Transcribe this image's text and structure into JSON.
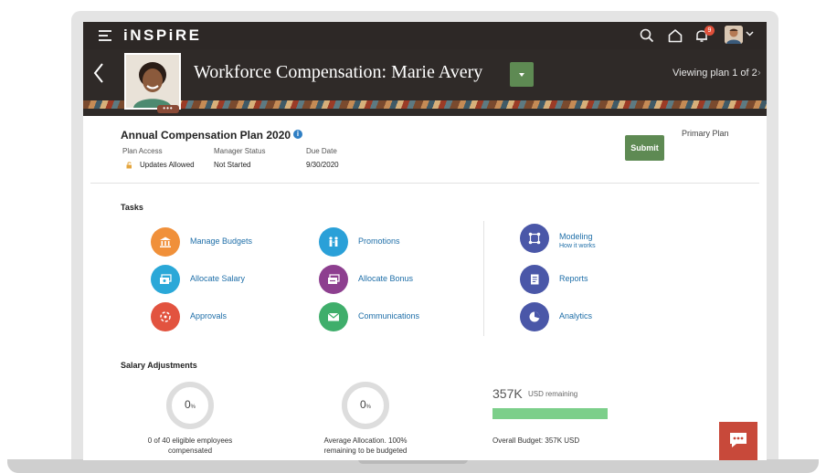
{
  "app": {
    "logo": "iNSPiRE"
  },
  "topbar": {
    "notifications_count": "9"
  },
  "header": {
    "title": "Workforce Compensation: Marie Avery",
    "profile_more": "•••",
    "viewing": "Viewing plan 1 of 2",
    "viewing_chevron": "›"
  },
  "plan": {
    "title": "Annual Compensation Plan 2020",
    "info": "i",
    "columns": [
      {
        "label": "Plan Access",
        "value": "Updates Allowed"
      },
      {
        "label": "Manager Status",
        "value": "Not Started"
      },
      {
        "label": "Due Date",
        "value": "9/30/2020"
      }
    ],
    "submit_label": "Submit",
    "primary_plan": "Primary Plan"
  },
  "tasks": {
    "label": "Tasks",
    "items": [
      {
        "label": "Manage Budgets",
        "icon": "bank-icon",
        "color": "#f0903a"
      },
      {
        "label": "Allocate Salary",
        "icon": "salary-icon",
        "color": "#2aa8d8"
      },
      {
        "label": "Approvals",
        "icon": "approvals-icon",
        "color": "#e2533f"
      },
      {
        "label": "Promotions",
        "icon": "promotions-icon",
        "color": "#2aa0d8"
      },
      {
        "label": "Allocate Bonus",
        "icon": "bonus-icon",
        "color": "#8d3f8f"
      },
      {
        "label": "Communications",
        "icon": "envelope-icon",
        "color": "#3fae6b"
      },
      {
        "label": "Modeling",
        "sub": "How it works",
        "icon": "modeling-icon",
        "color": "#4a57a8"
      },
      {
        "label": "Reports",
        "icon": "reports-icon",
        "color": "#4a57a8"
      },
      {
        "label": "Analytics",
        "icon": "analytics-icon",
        "color": "#4a57a8"
      }
    ]
  },
  "salary": {
    "label": "Salary Adjustments",
    "gauges": [
      {
        "value": "0",
        "unit": "%",
        "caption_line1": "0 of 40 eligible employees",
        "caption_line2": "compensated"
      },
      {
        "value": "0",
        "unit": "%",
        "caption_line1": "Average Allocation. 100%",
        "caption_line2": "remaining to be budgeted"
      }
    ],
    "remaining_amount": "357K",
    "remaining_unit": "USD remaining",
    "remaining_fraction": 1.0,
    "overall_budget": "Overall Budget: 357K USD"
  },
  "colors": {
    "topbar": "#2d2826",
    "accent_green": "#5e8a53",
    "link": "#1e6ea8",
    "budget_fill": "#7ccf8a",
    "chat": "#c8493a"
  }
}
